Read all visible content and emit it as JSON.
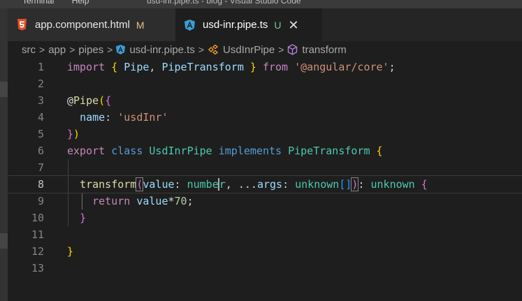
{
  "titlebar": {
    "menu": [
      "Terminal",
      "Help"
    ],
    "window_title": "usd-inr.pipe.ts - blog - Visual Studio Code"
  },
  "tabs": [
    {
      "label": "app.component.html",
      "status": "M",
      "icon": "html5-icon",
      "active": false
    },
    {
      "label": "usd-inr.pipe.ts",
      "status": "U",
      "icon": "angular-icon",
      "active": true,
      "close": "✕"
    }
  ],
  "breadcrumb": [
    "src",
    "app",
    "pipes",
    "usd-inr.pipe.ts",
    "UsdInrPipe",
    "transform"
  ],
  "editor": {
    "current_line": 8,
    "lines": [
      {
        "n": "1"
      },
      {
        "n": "2"
      },
      {
        "n": "3"
      },
      {
        "n": "4"
      },
      {
        "n": "5"
      },
      {
        "n": "6"
      },
      {
        "n": "7"
      },
      {
        "n": "8"
      },
      {
        "n": "9"
      },
      {
        "n": "10"
      },
      {
        "n": "11"
      },
      {
        "n": "12"
      },
      {
        "n": "13"
      }
    ],
    "code": {
      "l1": {
        "import": "import",
        "open": "{",
        "pipe": "Pipe",
        "comma": ",",
        "pt": "PipeTransform",
        "close": "}",
        "from": "from",
        "module": "'@angular/core'",
        "semi": ";"
      },
      "l3": {
        "at": "@",
        "decorator": "Pipe",
        "paren": "(",
        "brace": "{"
      },
      "l4": {
        "key": "name",
        "colon": ":",
        "value": "'usdInr'"
      },
      "l5": {
        "brace": "}",
        "paren": ")"
      },
      "l6": {
        "export": "export",
        "class": "class",
        "name": "UsdInrPipe",
        "implements": "implements",
        "iface": "PipeTransform",
        "brace": "{"
      },
      "l8": {
        "method": "transform",
        "open": "(",
        "param": "value",
        "c1": ":",
        "ptype": "numbe",
        "ptype2": "r",
        "comma": ",",
        "rest": "...",
        "args": "args",
        "c2": ":",
        "atype": "unknown",
        "arr": "[]",
        "close": ")",
        "c3": ":",
        "rtype": "unknown",
        "brace": "{"
      },
      "l9": {
        "return": "return",
        "value": "value",
        "op": "*",
        "num": "70",
        "semi": ";"
      },
      "l10": {
        "brace": "}"
      },
      "l12": {
        "brace": "}"
      }
    }
  }
}
